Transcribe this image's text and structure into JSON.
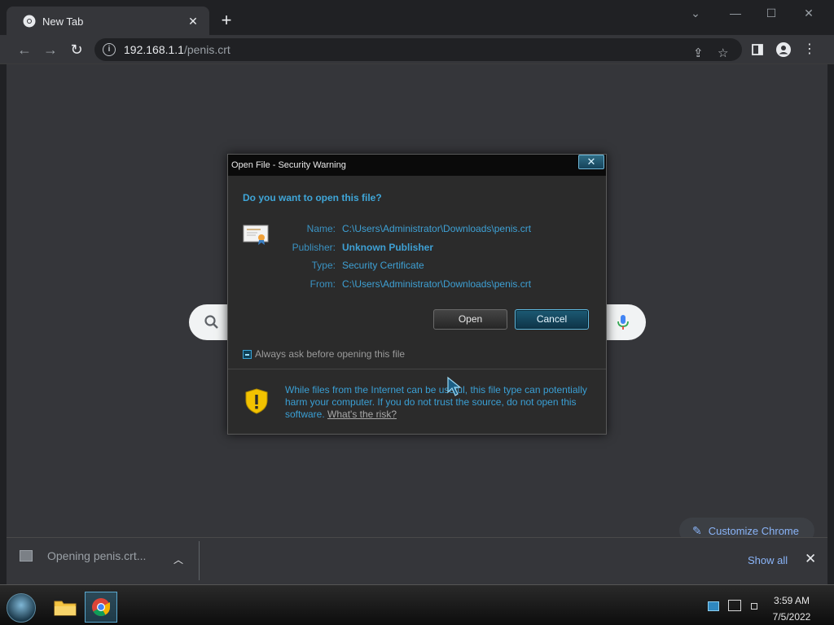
{
  "browser": {
    "tab_title": "New Tab",
    "tab_close": "✕",
    "new_tab": "+",
    "url_host": "192.168.1.1",
    "url_path": "/penis.crt"
  },
  "page": {
    "customize_label": "Customize Chrome"
  },
  "download_shelf": {
    "item_label": "Opening penis.crt...",
    "show_all": "Show all",
    "close": "✕"
  },
  "dialog": {
    "title": "Open File - Security Warning",
    "close": "✕",
    "question": "Do you want to open this file?",
    "fields": [
      {
        "key": "Name:",
        "value": "C:\\Users\\Administrator\\Downloads\\penis.crt"
      },
      {
        "key": "Publisher:",
        "value": "Unknown Publisher"
      },
      {
        "key": "Type:",
        "value": "Security Certificate"
      },
      {
        "key": "From:",
        "value": "C:\\Users\\Administrator\\Downloads\\penis.crt"
      }
    ],
    "open_button": "Open",
    "cancel_button": "Cancel",
    "checkbox_label": "Always ask before opening this file",
    "checkbox_checked": true,
    "warning_text": "While files from the Internet can be useful, this file type can potentially harm your computer. If you do not trust the source, do not open this software.",
    "warning_link": "What's the risk?"
  },
  "taskbar": {
    "time": "3:59 AM",
    "date": "7/5/2022"
  },
  "colors": {
    "accent_blue": "#3fa6d8",
    "chrome_link": "#8ab4f8",
    "shield_yellow": "#f2c200"
  }
}
